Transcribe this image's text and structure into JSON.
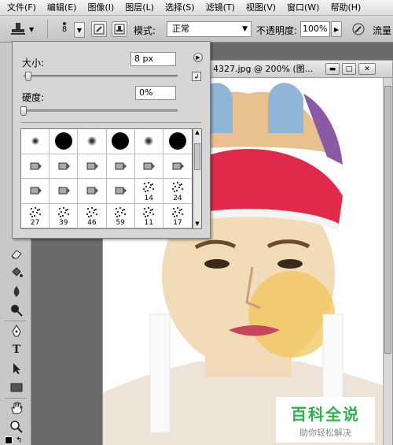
{
  "menubar": {
    "items": [
      "文件(F)",
      "编辑(E)",
      "图像(I)",
      "图层(L)",
      "选择(S)",
      "滤镜(T)",
      "视图(V)",
      "窗口(W)",
      "帮助(H)"
    ]
  },
  "options": {
    "tool_icon": "clone-stamp-icon",
    "brush_size_preview": "8",
    "mode_label": "模式:",
    "mode_value": "正常",
    "opacity_label": "不透明度:",
    "opacity_value": "100%",
    "flow_label": "流量"
  },
  "document": {
    "title": "4327.jpg @ 200% (图...",
    "buttons": [
      "min",
      "max",
      "close"
    ]
  },
  "brush_picker": {
    "size_label": "大小:",
    "size_value": "8 px",
    "size_level": 0.03,
    "hardness_label": "硬度:",
    "hardness_value": "0%",
    "hardness_level": 0.0,
    "brushes": [
      {
        "kind": "soft",
        "d": 10,
        "num": ""
      },
      {
        "kind": "hard",
        "d": 22,
        "num": ""
      },
      {
        "kind": "soft",
        "d": 12,
        "num": ""
      },
      {
        "kind": "hard",
        "d": 22,
        "num": ""
      },
      {
        "kind": "soft",
        "d": 12,
        "num": ""
      },
      {
        "kind": "hard",
        "d": 22,
        "num": ""
      },
      {
        "kind": "marker",
        "num": ""
      },
      {
        "kind": "marker",
        "num": ""
      },
      {
        "kind": "marker",
        "num": ""
      },
      {
        "kind": "marker",
        "num": ""
      },
      {
        "kind": "marker",
        "num": ""
      },
      {
        "kind": "marker",
        "num": ""
      },
      {
        "kind": "marker",
        "num": ""
      },
      {
        "kind": "marker",
        "num": ""
      },
      {
        "kind": "marker",
        "num": ""
      },
      {
        "kind": "marker",
        "num": ""
      },
      {
        "kind": "scatter",
        "num": "14"
      },
      {
        "kind": "scatter",
        "num": "24"
      },
      {
        "kind": "scatter",
        "num": "27"
      },
      {
        "kind": "scatter",
        "num": "39"
      },
      {
        "kind": "scatter",
        "num": "46"
      },
      {
        "kind": "scatter",
        "num": "59"
      },
      {
        "kind": "scatter",
        "num": "11"
      },
      {
        "kind": "scatter",
        "num": "17"
      }
    ]
  },
  "watermark": {
    "title": "百科全说",
    "subtitle": "助你轻松解决"
  },
  "colors": {
    "watermark_green": "#2bb24c",
    "panel_gray": "#d6d6d6"
  }
}
